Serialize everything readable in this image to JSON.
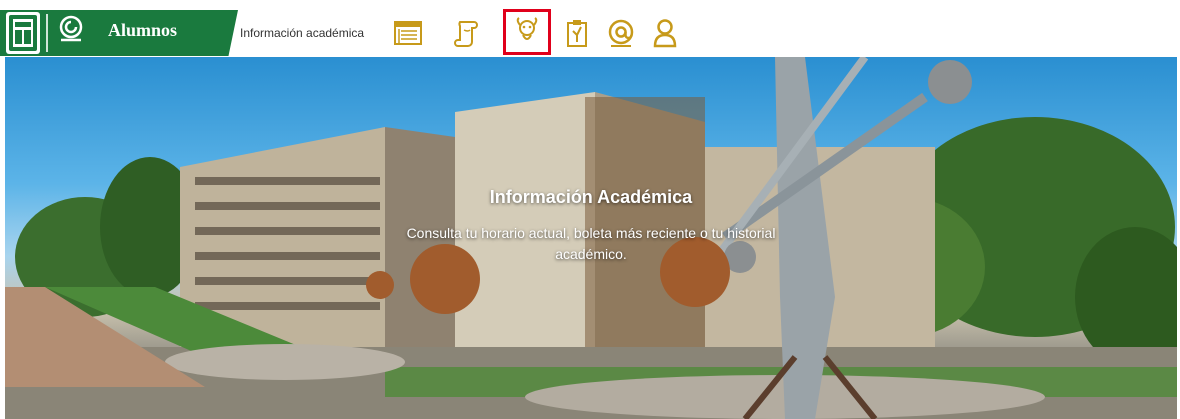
{
  "header": {
    "app_title": "Alumnos",
    "section_label": "Información académica",
    "colors": {
      "brand_green": "#1a7a3e",
      "icon_gold": "#c79a1a",
      "active_outline": "#e0001b"
    },
    "nav_icons": [
      {
        "name": "schedule-icon"
      },
      {
        "name": "scroll-icon"
      },
      {
        "name": "mascot-icon",
        "active": true
      },
      {
        "name": "clipboard-icon"
      },
      {
        "name": "at-sign-icon"
      },
      {
        "name": "user-icon"
      }
    ]
  },
  "hero": {
    "title": "Información Académica",
    "subtitle": "Consulta tu horario actual, boleta más reciente o tu historial académico."
  }
}
